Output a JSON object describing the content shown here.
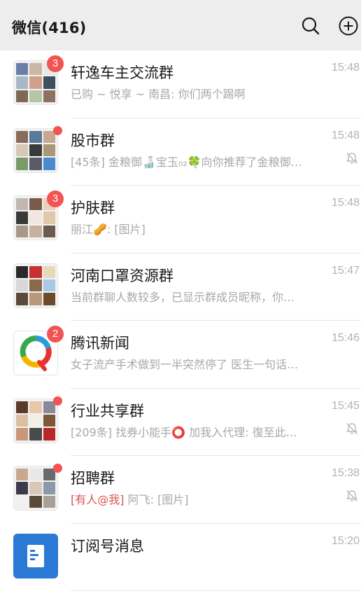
{
  "header": {
    "title": "微信(416)",
    "search_icon": "search-icon",
    "add_icon": "plus-circle-icon"
  },
  "colors": {
    "header_bg": "#ededed",
    "badge": "#f25353",
    "preview_text": "#a8a8a8",
    "mention": "#d9534f",
    "subscription_blue": "#2a7ad5"
  },
  "chats": [
    {
      "name": "轩逸车主交流群",
      "preview": "已购 ~ 悦享 ~ 南昌: 你们两个踢啊",
      "time": "15:48",
      "badge": "3",
      "muted": false
    },
    {
      "name": "股市群",
      "preview": "[45条] 金粮御🍶宝玉₀₂🍀向你推荐了金粮御…",
      "time": "15:48",
      "badge": "",
      "dot": true,
      "muted": true
    },
    {
      "name": "护肤群",
      "preview": "丽江🥜: [图片]",
      "time": "15:48",
      "badge": "3",
      "muted": false
    },
    {
      "name": "河南口罩资源群",
      "preview": "当前群聊人数较多，已显示群成员昵称，你…",
      "time": "15:47",
      "badge": "",
      "muted": false
    },
    {
      "name": "腾讯新闻",
      "preview": "女子流产手术做到一半突然停了 医生一句话…",
      "time": "15:46",
      "badge": "2",
      "muted": false
    },
    {
      "name": "行业共享群",
      "preview": "[209条] 找券小能手⭕ 加我入代理: 復至此…",
      "time": "15:45",
      "badge": "",
      "dot": true,
      "muted": true
    },
    {
      "name": "招聘群",
      "preview_mention": "[有人@我]",
      "preview": " 阿飞: [图片]",
      "time": "15:38",
      "badge": "",
      "dot": true,
      "muted": true
    },
    {
      "name": "订阅号消息",
      "preview": "",
      "time": "15:20",
      "badge": "",
      "muted": false
    }
  ]
}
